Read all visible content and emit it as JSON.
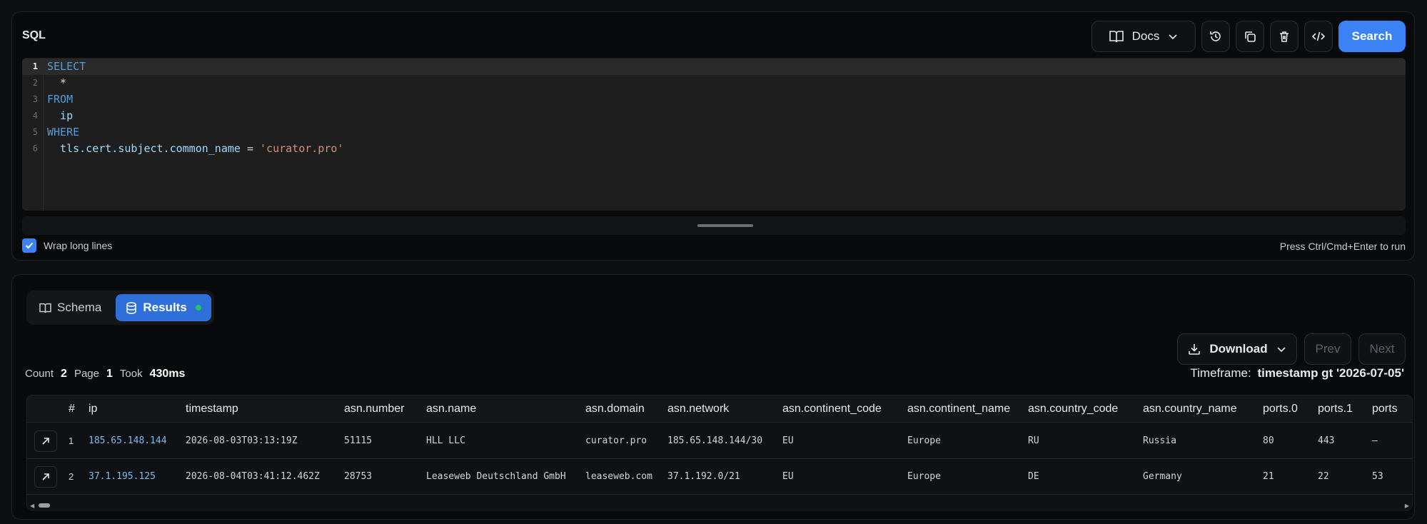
{
  "editor_panel": {
    "title": "SQL",
    "toolbar": {
      "docs_label": "Docs",
      "search_label": "Search",
      "icons": [
        "history-icon",
        "copy-icon",
        "trash-icon",
        "code-icon"
      ]
    },
    "code_lines": [
      {
        "num": "1",
        "tokens": [
          {
            "t": "SELECT",
            "k": "kw"
          }
        ]
      },
      {
        "num": "2",
        "tokens": [
          {
            "t": "  *",
            "k": "plain"
          }
        ]
      },
      {
        "num": "3",
        "tokens": [
          {
            "t": "FROM",
            "k": "kw"
          }
        ]
      },
      {
        "num": "4",
        "tokens": [
          {
            "t": "  ip",
            "k": "id"
          }
        ]
      },
      {
        "num": "5",
        "tokens": [
          {
            "t": "WHERE",
            "k": "kw"
          }
        ]
      },
      {
        "num": "6",
        "tokens": [
          {
            "t": "  tls.cert.subject.common_name",
            "k": "id"
          },
          {
            "t": " = ",
            "k": "plain"
          },
          {
            "t": "'curator.pro'",
            "k": "str"
          }
        ]
      }
    ],
    "wrap_label": "Wrap long lines",
    "wrap_checked": true,
    "run_hint": "Press Ctrl/Cmd+Enter to run"
  },
  "results_panel": {
    "tabs": [
      {
        "label": "Schema",
        "active": false
      },
      {
        "label": "Results",
        "active": true
      }
    ],
    "download_label": "Download",
    "prev_label": "Prev",
    "next_label": "Next",
    "stats": {
      "count_label": "Count",
      "count": "2",
      "page_label": "Page",
      "page": "1",
      "took_label": "Took",
      "took": "430ms"
    },
    "timeframe": {
      "label": "Timeframe:",
      "value": "timestamp gt '2026-07-05'"
    },
    "table": {
      "columns": [
        "#",
        "ip",
        "timestamp",
        "asn.number",
        "asn.name",
        "asn.domain",
        "asn.network",
        "asn.continent_code",
        "asn.continent_name",
        "asn.country_code",
        "asn.country_name",
        "ports.0",
        "ports.1",
        "ports"
      ],
      "rows": [
        [
          "1",
          "185.65.148.144",
          "2026-08-03T03:13:19Z",
          "51115",
          "HLL LLC",
          "curator.pro",
          "185.65.148.144/30",
          "EU",
          "Europe",
          "RU",
          "Russia",
          "80",
          "443",
          "–"
        ],
        [
          "2",
          "37.1.195.125",
          "2026-08-04T03:41:12.462Z",
          "28753",
          "Leaseweb Deutschland GmbH",
          "leaseweb.com",
          "37.1.192.0/21",
          "EU",
          "Europe",
          "DE",
          "Germany",
          "21",
          "22",
          "53"
        ]
      ]
    }
  }
}
